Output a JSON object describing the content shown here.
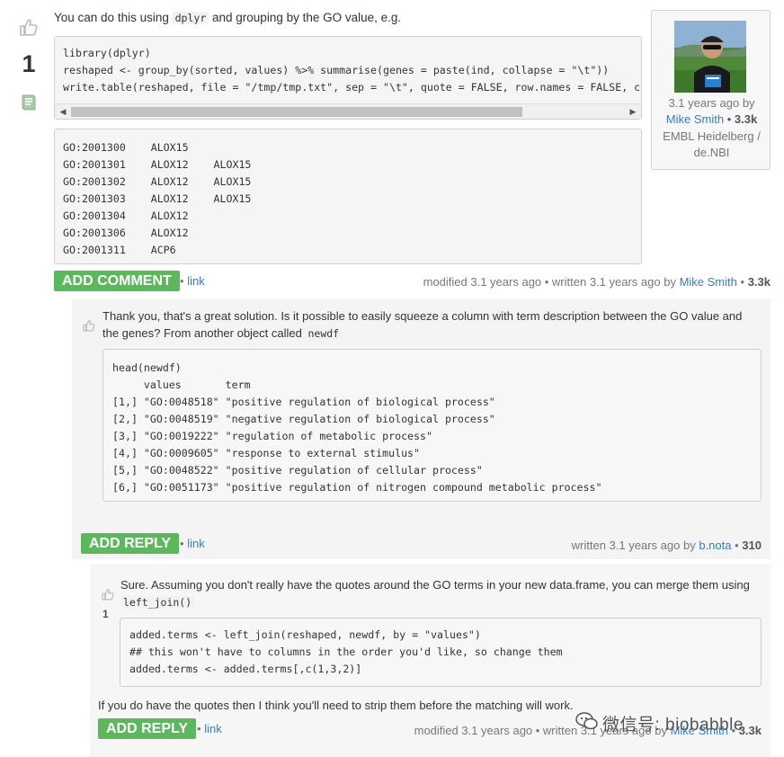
{
  "answer": {
    "intro_text": "You can do this using",
    "intro_code": "dplyr",
    "intro_rest": "and grouping by the GO value, e.g.",
    "vote_count": "1",
    "code_lines": [
      "library(dplyr)",
      "reshaped <- group_by(sorted, values) %>% summarise(genes = paste(ind, collapse = \"\\t\"))",
      "write.table(reshaped, file = \"/tmp/tmp.txt\", sep = \"\\t\", quote = FALSE, row.names = FALSE, c"
    ],
    "output_lines": [
      "GO:2001300    ALOX15",
      "GO:2001301    ALOX12    ALOX15",
      "GO:2001302    ALOX12    ALOX15",
      "GO:2001303    ALOX12    ALOX15",
      "GO:2001304    ALOX12",
      "GO:2001306    ALOX12",
      "GO:2001311    ACP6"
    ],
    "add_comment_label": "ADD COMMENT",
    "link_label": "link",
    "meta_prefix": "modified 3.1 years ago • written 3.1 years ago by",
    "meta_author": "Mike Smith",
    "meta_rep": "3.3k"
  },
  "user_card": {
    "time": "3.1 years ago by",
    "name": "Mike Smith",
    "rep": "3.3k",
    "affiliation_1": "EMBL Heidelberg /",
    "affiliation_2": "de.NBI"
  },
  "comment1": {
    "text_line1": "Thank you, that's a great solution. Is it possible to easily squeeze a column with term description between the GO value and",
    "text_line2_pre": "the genes? From another object called",
    "text_code": "newdf",
    "code_lines": [
      "head(newdf)",
      "     values       term",
      "[1,] \"GO:0048518\" \"positive regulation of biological process\"",
      "[2,] \"GO:0048519\" \"negative regulation of biological process\"",
      "[3,] \"GO:0019222\" \"regulation of metabolic process\"",
      "[4,] \"GO:0009605\" \"response to external stimulus\"",
      "[5,] \"GO:0048522\" \"positive regulation of cellular process\"",
      "[6,] \"GO:0051173\" \"positive regulation of nitrogen compound metabolic process\""
    ],
    "reply_label": "ADD REPLY",
    "link_label": "link",
    "meta_prefix": "written 3.1 years ago by",
    "meta_author": "b.nota",
    "meta_rep": "310"
  },
  "comment2": {
    "vote_count": "1",
    "text_line1": "Sure. Assuming you don't really have the quotes around the GO terms in your new data.frame, you can merge them using",
    "text_code": "left_join()",
    "code_lines": [
      "added.terms <- left_join(reshaped, newdf, by = \"values\")",
      "## this won't have to columns in the order you'd like, so change them",
      "added.terms <- added.terms[,c(1,3,2)]"
    ],
    "footer_text": "If you do have the quotes then I think you'll need to strip them before the matching will work.",
    "reply_label": "ADD REPLY",
    "link_label": "link",
    "meta_prefix": "modified 3.1 years ago • written 3.1 years ago by",
    "meta_author": "Mike Smith",
    "meta_rep": "3.3k"
  },
  "watermark": {
    "text": "微信号: biobabble"
  },
  "colors": {
    "green": "#5cb85c",
    "link": "#3b7dbd",
    "code_bg": "#f5f5f5",
    "comment_bg": "#f4f4f4"
  }
}
